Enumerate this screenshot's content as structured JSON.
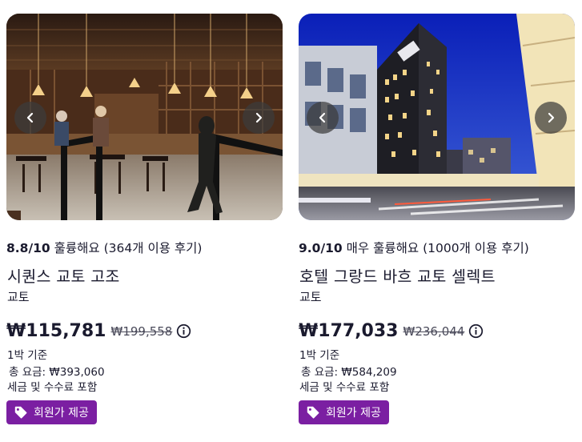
{
  "colors": {
    "badge_bg": "#7b1fa2",
    "text": "#1a1a2e"
  },
  "icons": {
    "prev": "chevron-left-icon",
    "next": "chevron-right-icon",
    "info": "info-circle-icon",
    "tag": "tag-icon"
  },
  "listings": [
    {
      "score": "8.8/10",
      "rating_text": "훌륭해요",
      "reviews": "(364개 이용 후기)",
      "name": "시퀀스 교토 고조",
      "city": "교토",
      "price": "₩115,781",
      "old_price": "₩199,558",
      "per_night": "1박 기준",
      "total": "총 요금: ₩393,060",
      "tax_note": "세금 및 수수료 포함",
      "badge": "회원가 제공"
    },
    {
      "score": "9.0/10",
      "rating_text": "매우 훌륭해요",
      "reviews": "(1000개 이용 후기)",
      "name": "호텔 그랑드 바흐 교토 셀렉트",
      "city": "교토",
      "price": "₩177,033",
      "old_price": "₩236,044",
      "per_night": "1박 기준",
      "total": "총 요금: ₩584,209",
      "tax_note": "세금 및 수수료 포함",
      "badge": "회원가 제공"
    }
  ]
}
